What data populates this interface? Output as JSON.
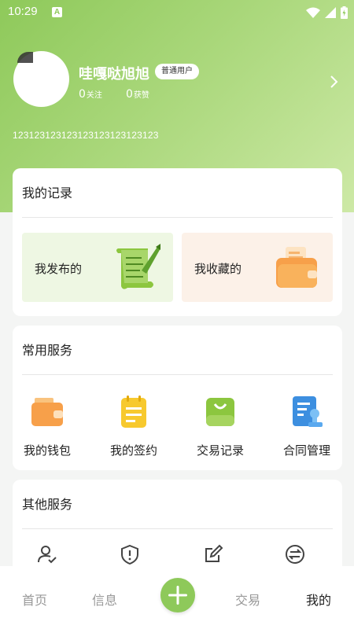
{
  "status_bar": {
    "time": "10:29",
    "app_glyph": "A"
  },
  "profile": {
    "username": "哇嘎哒旭旭",
    "badge": "普通用户",
    "following_count": "0",
    "following_label": "关注",
    "likes_count": "0",
    "likes_label": "获赞",
    "bio": "123123123123123123123123123"
  },
  "records": {
    "title": "我的记录",
    "items": [
      {
        "label": "我发布的",
        "icon": "scroll-quill-icon"
      },
      {
        "label": "我收藏的",
        "icon": "folder-wallet-icon"
      }
    ]
  },
  "services": {
    "title": "常用服务",
    "items": [
      {
        "label": "我的钱包",
        "icon": "wallet-icon"
      },
      {
        "label": "我的签约",
        "icon": "notepad-icon"
      },
      {
        "label": "交易记录",
        "icon": "bag-icon"
      },
      {
        "label": "合同管理",
        "icon": "contract-stamp-icon"
      }
    ]
  },
  "other": {
    "title": "其他服务",
    "items": [
      {
        "icon": "user-check-icon"
      },
      {
        "icon": "shield-alert-icon"
      },
      {
        "icon": "edit-icon"
      },
      {
        "icon": "exchange-icon"
      }
    ]
  },
  "tabs": [
    {
      "label": "首页"
    },
    {
      "label": "信息"
    },
    {
      "label": "交易"
    },
    {
      "label": "我的"
    }
  ],
  "colors": {
    "accent": "#8ec95a",
    "tile_green": "#eef7e3",
    "tile_orange": "#fcf1e8"
  }
}
